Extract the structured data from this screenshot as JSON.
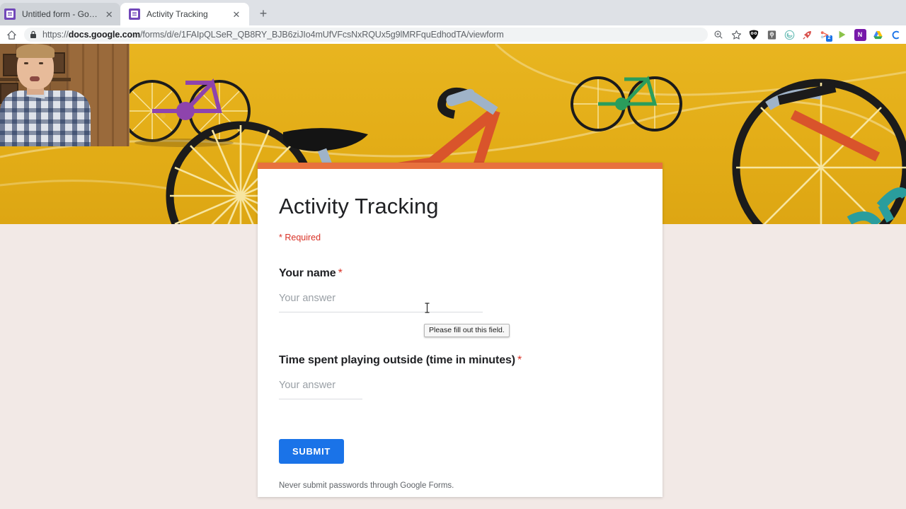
{
  "browser": {
    "tabs": [
      {
        "title": "Untitled form - Google Forms",
        "active": false,
        "close_label": "✕",
        "favicon": "google-forms-icon"
      },
      {
        "title": "Activity Tracking",
        "active": true,
        "close_label": "✕",
        "favicon": "google-forms-icon"
      }
    ],
    "new_tab_label": "+",
    "home_icon": "home-icon",
    "lock_icon": "lock-icon",
    "url": {
      "scheme": "https://",
      "host": "docs.google.com",
      "path": "/forms/d/e/1FAIpQLSeR_QB8RY_BJB6ziJIo4mUfVFcsNxRQUx5g9lMRFquEdhodTA/viewform",
      "full": "https://docs.google.com/forms/d/e/1FAIpQLSeR_QB8RY_BJB6ziJIo4mUfVFcsNxRQUx5g9lMRFquEdhodTA/viewform"
    },
    "toolbar_icons": [
      {
        "name": "zoom-in-icon",
        "glyph": "⌕",
        "color": "#5f6368",
        "type": "glyph"
      },
      {
        "name": "bookmark-star-icon",
        "glyph": "☆",
        "color": "#5f6368",
        "type": "glyph"
      },
      {
        "name": "owl-extension-icon",
        "glyph": "",
        "color": "#1c1c1c",
        "type": "ext"
      },
      {
        "name": "map-pin-extension-icon",
        "glyph": "",
        "color": "#4a4a4a",
        "type": "ext"
      },
      {
        "name": "spiral-extension-icon",
        "glyph": "",
        "color": "#6dbfb8",
        "type": "ext"
      },
      {
        "name": "rocket-extension-icon",
        "glyph": "",
        "color": "#d9534f",
        "type": "ext"
      },
      {
        "name": "screencast-extension-icon",
        "glyph": "",
        "color": "#ef6c5a",
        "type": "ext",
        "badge": "2"
      },
      {
        "name": "play-extension-icon",
        "glyph": "",
        "color": "#8bc34a",
        "type": "ext"
      },
      {
        "name": "onenote-extension-icon",
        "glyph": "N",
        "color": "#7719aa",
        "type": "ext"
      },
      {
        "name": "google-drive-extension-icon",
        "glyph": "",
        "color": "#4285f4",
        "type": "ext"
      },
      {
        "name": "profile-avatar-icon",
        "glyph": "C",
        "color": "#1a73e8",
        "type": "ext"
      }
    ]
  },
  "banner": {
    "name": "bicycle-illustration-banner",
    "background_color": "#e3ad17"
  },
  "webcam": {
    "name": "webcam-overlay"
  },
  "form": {
    "title": "Activity Tracking",
    "required_note": "* Required",
    "accent_color": "#e8713d",
    "questions": [
      {
        "label": "Time spent playing outside (time in minutes)",
        "required_marker": "*",
        "placeholder": "Your answer",
        "value": ""
      },
      {
        "label": "Your name",
        "required_marker": "*",
        "placeholder": "Your answer",
        "value": ""
      }
    ],
    "q1": {
      "label": "Your name",
      "required_marker": "*",
      "placeholder": "Your answer",
      "value": ""
    },
    "q2": {
      "label": "Time spent playing outside (time in minutes)",
      "required_marker": "*",
      "placeholder": "Your answer",
      "value": ""
    },
    "validation_tooltip": "Please fill out this field.",
    "submit_label": "SUBMIT",
    "footer_note": "Never submit passwords through Google Forms."
  },
  "page_background_color": "#f2e9e6"
}
